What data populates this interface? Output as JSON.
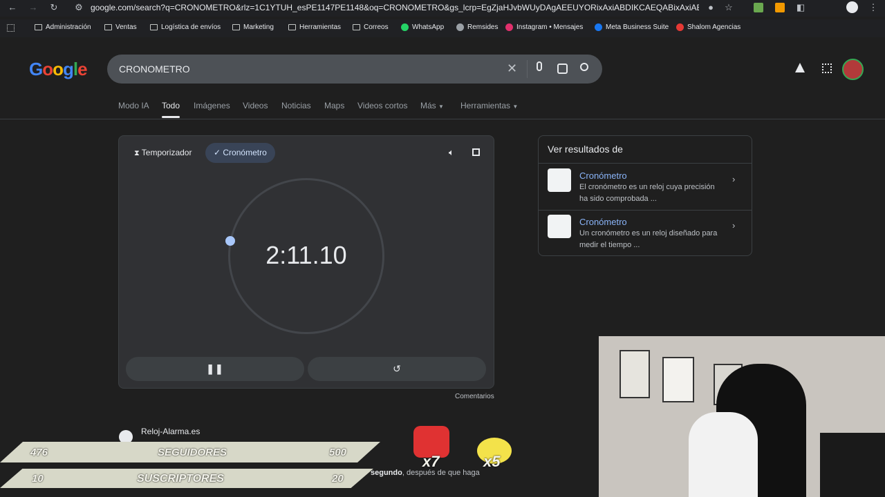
{
  "browser": {
    "url": "google.com/search?q=CRONOMETRO&rlz=1C1YTUH_esPE1147PE1148&oq=CRONOMETRO&gs_lcrp=EgZjaHJvbWUyDAgAEEUYORixAxiABDIKCAEQABixAxiABDIHCAIQA...",
    "bookmarks": [
      "Administración",
      "Ventas",
      "Logística de envíos",
      "Marketing",
      "Herramientas",
      "Correos",
      "WhatsApp",
      "Remsides",
      "Instagram • Mensajes",
      "Meta Business Suite",
      "Shalom Agencias"
    ]
  },
  "google": {
    "logo": "Google",
    "query": "CRONOMETRO",
    "tabs": [
      "Modo IA",
      "Todo",
      "Imágenes",
      "Videos",
      "Noticias",
      "Maps",
      "Videos cortos",
      "Más",
      "Herramientas"
    ]
  },
  "stopwatch": {
    "chip_timer": "Temporizador",
    "chip_stopwatch": "Cronómetro",
    "time": "2:11.10",
    "feedback": "Comentarios"
  },
  "panel": {
    "heading": "Ver resultados de",
    "results": [
      {
        "title": "Cronómetro",
        "desc": "El cronómetro es un reloj cuya precisión ha sido comprobada ..."
      },
      {
        "title": "Cronómetro",
        "desc": "Un cronómetro es un reloj diseñado para medir el tiempo ..."
      }
    ]
  },
  "result": {
    "site": "Reloj-Alarma.es",
    "snippet_bold": "segundo",
    "snippet_end": ", después de que haga"
  },
  "overlay": {
    "followers_count": "476",
    "followers_label": "SEGUIDORES",
    "followers_goal": "500",
    "subs_count": "10",
    "subs_label": "SUSCRIPTORES",
    "subs_goal": "20",
    "cat_badge": "x7",
    "face_badge": "x5"
  }
}
